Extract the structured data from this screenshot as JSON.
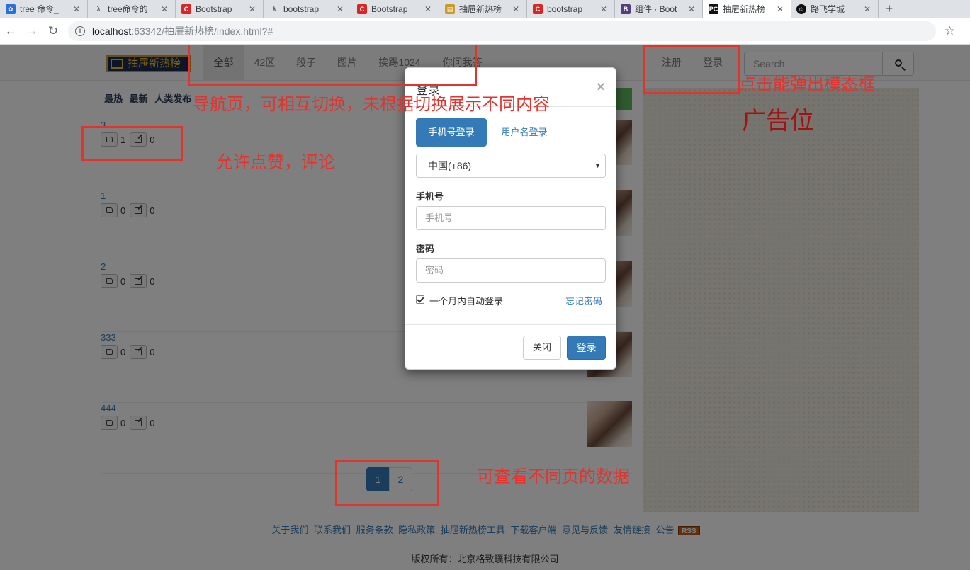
{
  "browser": {
    "tabs": [
      {
        "title": "tree 命令_",
        "icon": "paw-icon",
        "color": "#2a6fdb"
      },
      {
        "title": "tree命令的",
        "icon": "lambda-icon",
        "color": "#555555"
      },
      {
        "title": "Bootstrap",
        "icon": "c-logo-icon",
        "color": "#d92525"
      },
      {
        "title": "bootstrap",
        "icon": "lambda-icon",
        "color": "#555555"
      },
      {
        "title": "Bootstrap",
        "icon": "c-logo-icon",
        "color": "#d92525"
      },
      {
        "title": "抽屉新热榜",
        "icon": "drawer-logo-icon",
        "color": "#c79c2a"
      },
      {
        "title": "bootstrap",
        "icon": "c-logo-icon",
        "color": "#d92525"
      },
      {
        "title": "组件 · Boot",
        "icon": "b-logo-icon",
        "color": "#563d7c"
      },
      {
        "title": "抽屉新热榜",
        "icon": "pycharm-icon",
        "color": "#111111",
        "active": true
      },
      {
        "title": "路飞学城",
        "icon": "luffy-icon",
        "color": "#111111"
      }
    ],
    "url_host": "localhost",
    "url_path": ":63342/抽屉新热榜/index.html?#"
  },
  "navbar": {
    "brand": "抽屉新热榜",
    "links": [
      "全部",
      "42区",
      "段子",
      "图片",
      "挨踢1024",
      "你问我答"
    ],
    "right_links": [
      "注册",
      "登录"
    ],
    "search_placeholder": "Search"
  },
  "sort_tabs": [
    "最热",
    "最新",
    "人类发布"
  ],
  "items": [
    {
      "title": "3",
      "likes": "1",
      "comments": "0"
    },
    {
      "title": "1",
      "likes": "0",
      "comments": "0"
    },
    {
      "title": "2",
      "likes": "0",
      "comments": "0"
    },
    {
      "title": "333",
      "likes": "0",
      "comments": "0"
    },
    {
      "title": "444",
      "likes": "0",
      "comments": "0"
    }
  ],
  "pagination": [
    "1",
    "2"
  ],
  "footer": {
    "links": [
      "关于我们",
      "联系我们",
      "服务条款",
      "隐私政策",
      "抽屉新热榜工具",
      "下载客户端",
      "意见与反馈",
      "友情链接",
      "公告"
    ],
    "rss": "RSS",
    "copyright": "版权所有：北京格致璞科技有限公司"
  },
  "modal": {
    "title": "登录",
    "close_glyph": "×",
    "tabs": [
      "手机号登录",
      "用户名登录"
    ],
    "country": "中国(+86)",
    "phone_label": "手机号",
    "phone_placeholder": "手机号",
    "password_label": "密码",
    "password_placeholder": "密码",
    "remember": "一个月内自动登录",
    "remember_checked": true,
    "forgot": "忘记密码",
    "close_button": "关闭",
    "login_button": "登录"
  },
  "annotations": {
    "nav": "导航页，可相互切换，未根据切换展示不同内容",
    "like": "允许点赞，评论",
    "modal": "点击能弹出模态框",
    "ad": "广告位",
    "pager": "可查看不同页的数据"
  },
  "colors": {
    "primary": "#337ab7",
    "annotation": "#e5322d",
    "ad_label": "#a31212"
  }
}
